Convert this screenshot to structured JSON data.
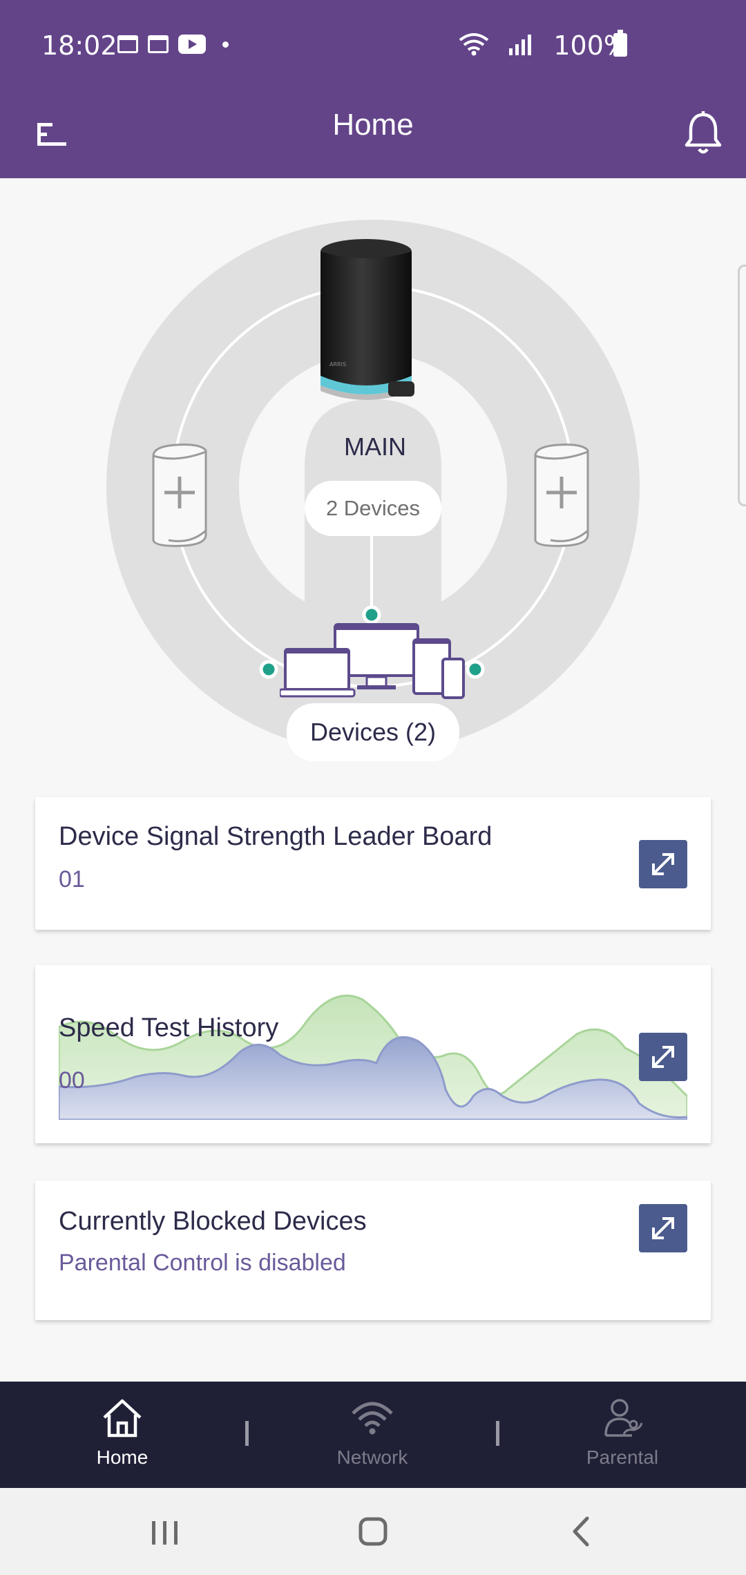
{
  "status_bar": {
    "time": "18:02",
    "battery": "100%",
    "icons": [
      "calendar-icon",
      "calendar-icon",
      "youtube-icon",
      "dot-icon",
      "wifi-icon",
      "signal-icon",
      "battery-icon"
    ]
  },
  "app_bar": {
    "title": "Home",
    "menu_icon": "menu-icon",
    "notification_icon": "bell-icon"
  },
  "mesh": {
    "main_label": "MAIN",
    "main_devices": "2 Devices",
    "devices_label": "Devices (2)",
    "add_satellite_icon": "add-satellite-icon"
  },
  "cards": {
    "leader_board": {
      "title": "Device Signal Strength Leader Board",
      "value": "01"
    },
    "speed_test": {
      "title": "Speed Test History",
      "value": "00"
    },
    "blocked": {
      "title": "Currently Blocked Devices",
      "value": "Parental Control is disabled"
    }
  },
  "bottom_nav": {
    "items": [
      {
        "label": "Home",
        "icon": "home-icon",
        "active": true
      },
      {
        "label": "Network",
        "icon": "wifi-icon",
        "active": false
      },
      {
        "label": "Parental",
        "icon": "parental-icon",
        "active": false
      }
    ]
  },
  "colors": {
    "brand_purple": "#634489",
    "nav_dark": "#1f2036",
    "accent_teal": "#1fa08a",
    "button_blue": "#4c5b8e"
  }
}
